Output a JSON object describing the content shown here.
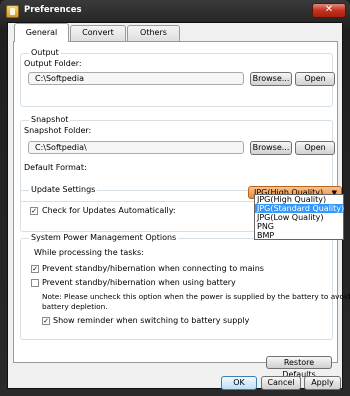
{
  "window": {
    "title": "Preferences",
    "close_glyph": "✕"
  },
  "tabs": [
    {
      "label": "General",
      "active": true
    },
    {
      "label": "Convert",
      "active": false
    },
    {
      "label": "Others",
      "active": false
    }
  ],
  "output": {
    "group_title": "Output",
    "folder_label": "Output Folder:",
    "folder_value": "C:\\Softpedia",
    "browse_label": "Browse...",
    "open_label": "Open"
  },
  "snapshot": {
    "group_title": "Snapshot",
    "folder_label": "Snapshot Folder:",
    "folder_value": "C:\\Softpedia\\",
    "browse_label": "Browse...",
    "open_label": "Open",
    "format_label": "Default Format:",
    "format_selected": "JPG(High Quality)",
    "format_options": [
      "JPG(High Quality)",
      "JPG(Standard Quality)",
      "JPG(Low Quality)",
      "PNG",
      "BMP"
    ],
    "format_highlighted_index": 1
  },
  "updates": {
    "group_title": "Update Settings",
    "check_label": "Check for Updates Automatically:",
    "check_checked": true
  },
  "power": {
    "group_title": "System Power Management Options",
    "while_label": "While processing the tasks:",
    "prevent_mains_label": "Prevent standby/hibernation when connecting to mains",
    "prevent_mains_checked": true,
    "prevent_battery_label": "Prevent standby/hibernation when using battery",
    "prevent_battery_checked": false,
    "note_line1": "Note: Please uncheck this option when the power is supplied by the battery to avoid",
    "note_line2": "battery depletion.",
    "reminder_label": "Show reminder when switching to battery supply",
    "reminder_checked": true
  },
  "footer": {
    "restore_label": "Restore Defaults",
    "ok_label": "OK",
    "cancel_label": "Cancel",
    "apply_label": "Apply"
  },
  "check_glyph": "✓",
  "dropdown_arrow": "▼",
  "colors": {
    "accent_orange": "#ec8a3a",
    "selection_blue": "#3399ff",
    "close_red": "#c3311e"
  }
}
